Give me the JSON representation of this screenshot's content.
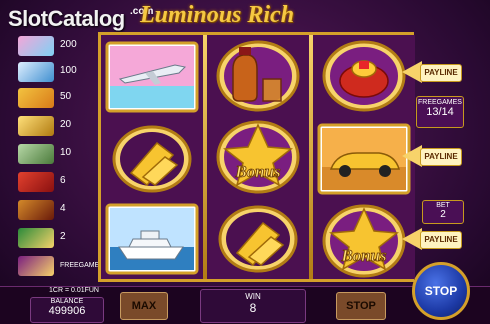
{
  "brand": {
    "logo_text": "SlotCatalog",
    "logo_suffix": ".com"
  },
  "game_title": "Luminous Rich",
  "paytable": [
    {
      "icon": "paytable-jet-icon",
      "value": "200"
    },
    {
      "icon": "paytable-yacht-icon",
      "value": "100"
    },
    {
      "icon": "paytable-car-icon",
      "value": "50"
    },
    {
      "icon": "paytable-gold-bars-icon",
      "value": "20"
    },
    {
      "icon": "paytable-cash-icon",
      "value": "10"
    },
    {
      "icon": "paytable-ring-icon",
      "value": "6"
    },
    {
      "icon": "paytable-cognac-icon",
      "value": "4"
    },
    {
      "icon": "paytable-dollar-icon",
      "value": "2"
    },
    {
      "icon": "paytable-bonus-icon",
      "value": "FREEGAMES"
    }
  ],
  "reels": [
    [
      "jet",
      "gold-bars",
      "yacht"
    ],
    [
      "cognac",
      "bonus",
      "gold-bars"
    ],
    [
      "ring",
      "car",
      "bonus"
    ]
  ],
  "bonus_label": "Bonus",
  "side": {
    "payline_label": "PAYLINE",
    "freegames_label": "FREEGAMES",
    "freegames_value": "13/14",
    "bet_label": "BET",
    "bet_value": "2"
  },
  "bottom": {
    "coin_info": "1CR = 0.01FUN",
    "balance_label": "BALANCE",
    "balance_value": "499906",
    "max_label": "MAX",
    "win_label": "WIN",
    "win_value": "8",
    "stop_label": "STOP",
    "spin_label": "STOP"
  },
  "colors": {
    "gold": "#d4a02a",
    "purple": "#4b1050",
    "spin_blue": "#1d3aa6"
  }
}
